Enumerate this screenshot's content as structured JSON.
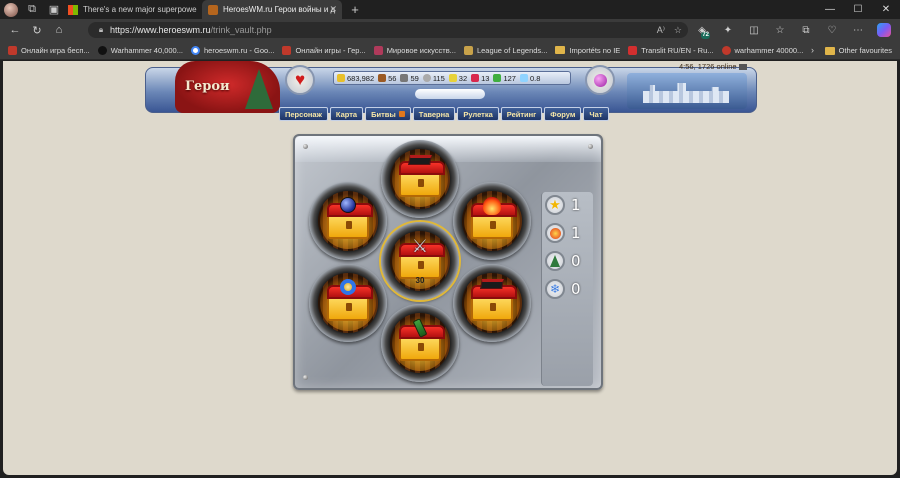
{
  "browser": {
    "tabs": [
      {
        "title": "There's a new major superpowe",
        "active": false
      },
      {
        "title": "HeroesWM.ru Герои войны и д",
        "active": true
      }
    ],
    "url_host": "https://www.heroeswm.ru",
    "url_path": "/trink_vault.php",
    "extension_badge": "72",
    "bookmarks": [
      {
        "label": "Онлайн игра бесп...",
        "color": "#c0392b"
      },
      {
        "label": "Warhammer 40,000...",
        "color": "#222222"
      },
      {
        "label": "heroeswm.ru - Goo...",
        "color": "#4285f4"
      },
      {
        "label": "Онлайн игры - Гер...",
        "color": "#c0392b"
      },
      {
        "label": "Мировое искусств...",
        "color": "#b03a5b"
      },
      {
        "label": "League of Legends...",
        "color": "#c8a24a"
      },
      {
        "label": "Importéts no IE",
        "color": "#e0b54a"
      },
      {
        "label": "Translit RU/EN - Ru...",
        "color": "#d32f2f"
      },
      {
        "label": "warhammer 40000...",
        "color": "#c0392b"
      }
    ],
    "other_favourites": "Other favourites"
  },
  "game": {
    "online_text": "4:56, 1726 online",
    "resources": [
      {
        "icon": "gold-icon",
        "value": "683,982",
        "color": "#e8c02a"
      },
      {
        "icon": "wood-icon",
        "value": "56",
        "color": "#9b5a23"
      },
      {
        "icon": "ore-icon",
        "value": "59",
        "color": "#777777"
      },
      {
        "icon": "mercury-icon",
        "value": "115",
        "color": "#aaaaaa"
      },
      {
        "icon": "sulfur-icon",
        "value": "32",
        "color": "#e7d23a"
      },
      {
        "icon": "crystal-icon",
        "value": "13",
        "color": "#d8284d"
      },
      {
        "icon": "gems-icon",
        "value": "127",
        "color": "#3fae3f"
      },
      {
        "icon": "diamond-icon",
        "value": "0.8",
        "color": "#8fd3ff"
      }
    ],
    "menu": [
      "Персонаж",
      "Карта",
      "Битвы",
      "Таверна",
      "Рулетка",
      "Рейтинг",
      "Форум",
      "Чат"
    ],
    "center_count": "30",
    "counters": [
      {
        "icon": "star-icon",
        "value": "1"
      },
      {
        "icon": "fire-icon",
        "value": "1"
      },
      {
        "icon": "tree-icon",
        "value": "0"
      },
      {
        "icon": "snowflake-icon",
        "value": "0"
      }
    ]
  }
}
